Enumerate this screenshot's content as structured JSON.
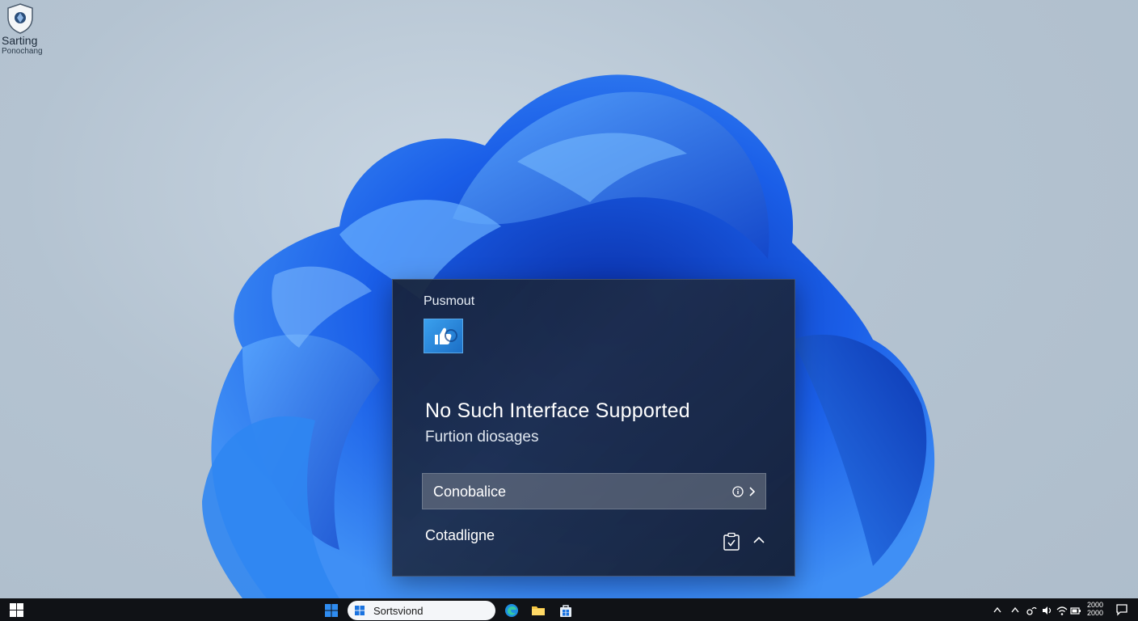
{
  "desktop_icon": {
    "title": "Sarting",
    "subtitle": "Ponochang"
  },
  "dialog": {
    "app_name": "Pusmout",
    "headline": "No Such Interface Supported",
    "subline": "Furtion diosages",
    "option_label": "Conobalice",
    "footer_label": "Cotadligne"
  },
  "taskbar": {
    "search_text": "Sortsviond",
    "clock_line1": "2000",
    "clock_line2": "2000"
  },
  "icons": {
    "desktop": "shield-icon",
    "app": "thumbs-up-icon",
    "option_info": "info-circle-icon",
    "option_chevron": "chevron-right-icon",
    "footer_clip": "clipboard-check-icon",
    "footer_up": "chevron-up-icon"
  },
  "colors": {
    "accent": "#1c6fc6",
    "dialog_bg": "#16223a",
    "taskbar_bg": "#101216"
  }
}
